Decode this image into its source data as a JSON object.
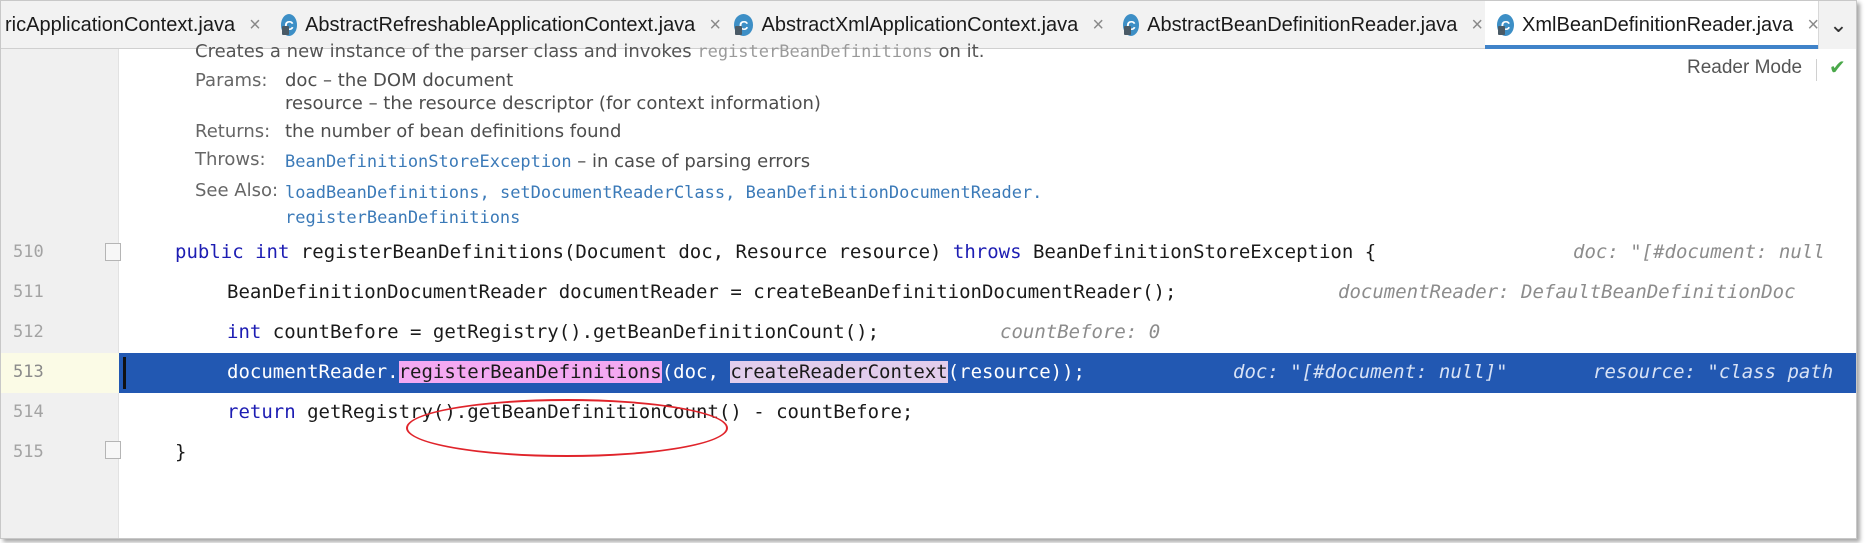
{
  "tabs": [
    {
      "label": "ricApplicationContext.java",
      "icon": "class-icon",
      "active": false
    },
    {
      "label": "AbstractRefreshableApplicationContext.java",
      "icon": "class-icon",
      "active": false
    },
    {
      "label": "AbstractXmlApplicationContext.java",
      "icon": "class-icon",
      "active": false
    },
    {
      "label": "AbstractBeanDefinitionReader.java",
      "icon": "class-icon",
      "active": false
    },
    {
      "label": "XmlBeanDefinitionReader.java",
      "icon": "class-icon",
      "active": true
    }
  ],
  "tab_close_glyph": "×",
  "class_icon_letter": "C",
  "doc": {
    "summary_prefix": "Creates a new instance of the parser class and invokes ",
    "summary_code": "registerBeanDefinitions",
    "summary_suffix": " on it.",
    "params_label": "Params:",
    "param1": "doc – the DOM document",
    "param2": "resource – the resource descriptor (for context information)",
    "returns_label": "Returns:",
    "returns_value": "the number of bean definitions found",
    "throws_label": "Throws:",
    "throws_link": "BeanDefinitionStoreException",
    "throws_text": " – in case of parsing errors",
    "see_also_label": "See Also:",
    "see_also_links": [
      "loadBeanDefinitions",
      "setDocumentReaderClass",
      "BeanDefinitionDocumentReader."
    ],
    "see_also_link_last": "registerBeanDefinitions",
    "reader_mode_label": "Reader Mode",
    "reader_check": "✔"
  },
  "code_lines": [
    {
      "num": "510"
    },
    {
      "num": "511"
    },
    {
      "num": "512"
    },
    {
      "num": "513"
    },
    {
      "num": "514"
    },
    {
      "num": "515"
    }
  ],
  "code": {
    "l510_public": "public",
    "l510_int": "int",
    "l510_body": " registerBeanDefinitions(Document doc, Resource resource) ",
    "l510_throws": "throws",
    "l510_tail": " BeanDefinitionStoreException {",
    "l510_hint": "doc: \"[#document: null",
    "l511_body": "BeanDefinitionDocumentReader documentReader = createBeanDefinitionDocumentReader();",
    "l511_hint": "documentReader: DefaultBeanDefinitionDoc",
    "l512_int": "int",
    "l512_body": " countBefore = getRegistry().getBeanDefinitionCount();",
    "l512_hint": "countBefore: 0",
    "l513_a": "documentReader.",
    "l513_b": "registerBeanDefinitions",
    "l513_c": "(doc, ",
    "l513_d": "createReaderContext",
    "l513_e": "(resource));",
    "l513_hint1": "doc: \"[#document: null]\"",
    "l513_hint2": "resource: \"class path",
    "l514_return": "return",
    "l514_body": " getRegistry().getBeanDefinitionCount() - countBefore;",
    "l515_body": "}"
  },
  "colors": {
    "execution_line": "#2258b2",
    "keyword": "#1d1db3",
    "highlight_method": "#f4a9f2",
    "highlight_call": "#e2cdec",
    "annotation_ellipse": "#e0242b",
    "active_tab_underline": "#4083c9"
  },
  "dropdown_glyph": "⌄"
}
